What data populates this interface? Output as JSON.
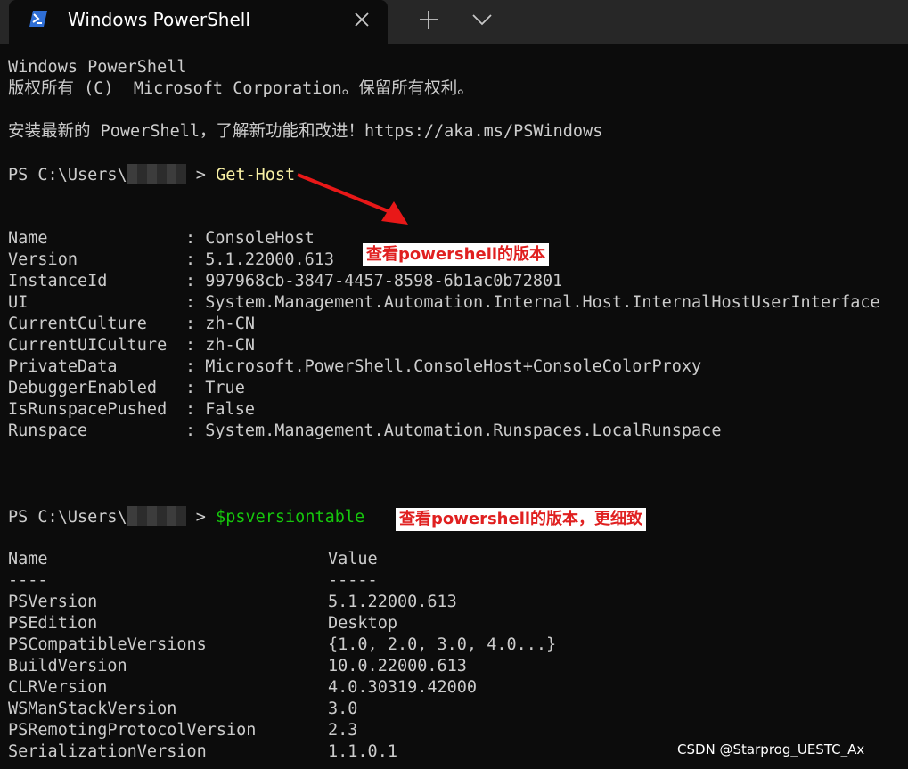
{
  "window": {
    "tab_title": "Windows PowerShell",
    "icons": {
      "app": "powershell-icon",
      "close": "close-icon",
      "new_tab": "plus-icon",
      "dropdown": "chevron-down-icon"
    }
  },
  "colors": {
    "background": "#0c0c0c",
    "text": "#cccccc",
    "command": "#f9f1a5",
    "variable": "#16c60c",
    "annotation": "#e02020"
  },
  "terminal": {
    "banner_line1": "Windows PowerShell",
    "banner_line2": "版权所有 (C)  Microsoft Corporation。保留所有权利。",
    "banner_line3": "安装最新的 PowerShell，了解新功能和改进！https://aka.ms/PSWindows",
    "prompt1": "PS C:\\Users\\",
    "prompt1_end": " > ",
    "command1": "Get-Host",
    "gethost": [
      {
        "key": "Name",
        "value": "ConsoleHost"
      },
      {
        "key": "Version",
        "value": "5.1.22000.613"
      },
      {
        "key": "InstanceId",
        "value": "997968cb-3847-4457-8598-6b1ac0b72801"
      },
      {
        "key": "UI",
        "value": "System.Management.Automation.Internal.Host.InternalHostUserInterface"
      },
      {
        "key": "CurrentCulture",
        "value": "zh-CN"
      },
      {
        "key": "CurrentUICulture",
        "value": "zh-CN"
      },
      {
        "key": "PrivateData",
        "value": "Microsoft.PowerShell.ConsoleHost+ConsoleColorProxy"
      },
      {
        "key": "DebuggerEnabled",
        "value": "True"
      },
      {
        "key": "IsRunspacePushed",
        "value": "False"
      },
      {
        "key": "Runspace",
        "value": "System.Management.Automation.Runspaces.LocalRunspace"
      }
    ],
    "separator": ": ",
    "prompt2": "PS C:\\Users\\",
    "prompt2_end": " > ",
    "command2": "$psversiontable",
    "table_headers": {
      "name": "Name",
      "value": "Value",
      "name_rule": "----",
      "value_rule": "-----"
    },
    "psversiontable": [
      {
        "name": "PSVersion",
        "value": "5.1.22000.613"
      },
      {
        "name": "PSEdition",
        "value": "Desktop"
      },
      {
        "name": "PSCompatibleVersions",
        "value": "{1.0, 2.0, 3.0, 4.0...}"
      },
      {
        "name": "BuildVersion",
        "value": "10.0.22000.613"
      },
      {
        "name": "CLRVersion",
        "value": "4.0.30319.42000"
      },
      {
        "name": "WSManStackVersion",
        "value": "3.0"
      },
      {
        "name": "PSRemotingProtocolVersion",
        "value": "2.3"
      },
      {
        "name": "SerializationVersion",
        "value": "1.1.0.1"
      }
    ]
  },
  "annotations": {
    "note1": "查看powershell的版本",
    "note2": "查看powershell的版本，更细致"
  },
  "watermark": "CSDN @Starprog_UESTC_Ax"
}
